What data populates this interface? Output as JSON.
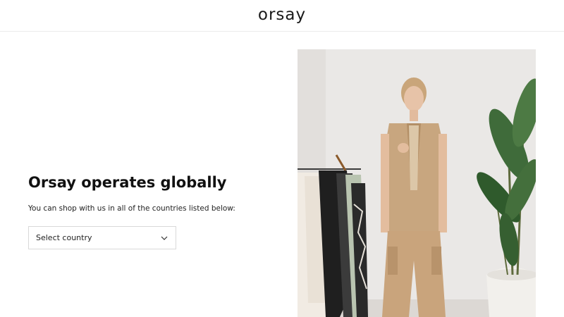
{
  "header": {
    "logo_text": "orsay"
  },
  "main": {
    "headline": "Orsay operates globally",
    "subline": "You can shop with us in all of the countries listed below:",
    "country_select": {
      "selected_label": "Select country",
      "icon": "chevron-down-icon"
    }
  },
  "hero_image": {
    "subject": "model-in-beige-vest-and-cargo-trousers"
  },
  "colors": {
    "text": "#111111",
    "border": "#d9d9d9",
    "background": "#ffffff"
  }
}
